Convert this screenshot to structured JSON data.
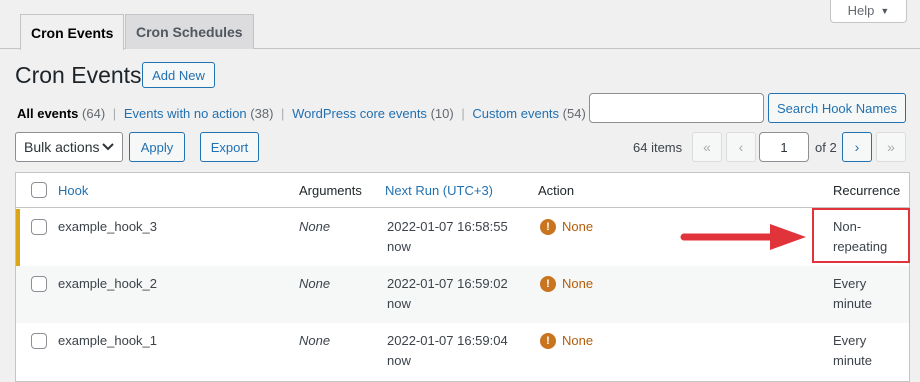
{
  "help": {
    "label": "Help"
  },
  "tabs": [
    {
      "label": "Cron Events",
      "active": true
    },
    {
      "label": "Cron Schedules",
      "active": false
    }
  ],
  "page": {
    "title": "Cron Events",
    "add_new": "Add New"
  },
  "views": [
    {
      "label": "All events",
      "count": "(64)",
      "current": true
    },
    {
      "label": "Events with no action",
      "count": "(38)"
    },
    {
      "label": "WordPress core events",
      "count": "(10)"
    },
    {
      "label": "Custom events",
      "count": "(54)"
    }
  ],
  "search": {
    "button": "Search Hook Names",
    "value": ""
  },
  "tablenav": {
    "bulk_actions": "Bulk actions",
    "apply": "Apply",
    "export": "Export",
    "items": "64 items",
    "first": "«",
    "prev": "‹",
    "current_page": "1",
    "of_total": "of 2",
    "next": "›",
    "last": "»"
  },
  "columns": {
    "hook": "Hook",
    "arguments": "Arguments",
    "next_run": "Next Run (UTC+3)",
    "action": "Action",
    "recurrence": "Recurrence"
  },
  "rows": [
    {
      "hook": "example_hook_3",
      "arguments": "None",
      "next_run": "2022-01-07 16:58:55",
      "relative": "now",
      "action": "None",
      "recurrence_1": "Non-",
      "recurrence_2": "repeating"
    },
    {
      "hook": "example_hook_2",
      "arguments": "None",
      "next_run": "2022-01-07 16:59:02",
      "relative": "now",
      "action": "None",
      "recurrence_1": "Every",
      "recurrence_2": "minute"
    },
    {
      "hook": "example_hook_1",
      "arguments": "None",
      "next_run": "2022-01-07 16:59:04",
      "relative": "now",
      "action": "None",
      "recurrence_1": "Every",
      "recurrence_2": "minute"
    }
  ],
  "colors": {
    "accent": "#2271b1",
    "highlight_border": "#dba617",
    "annotation": "#e1343a",
    "warning": "#b35c0a"
  },
  "icons": {
    "warning": "exclamation-circle-icon",
    "arrow": "red-arrow-icon",
    "dropdown": "chevron-down-icon"
  }
}
